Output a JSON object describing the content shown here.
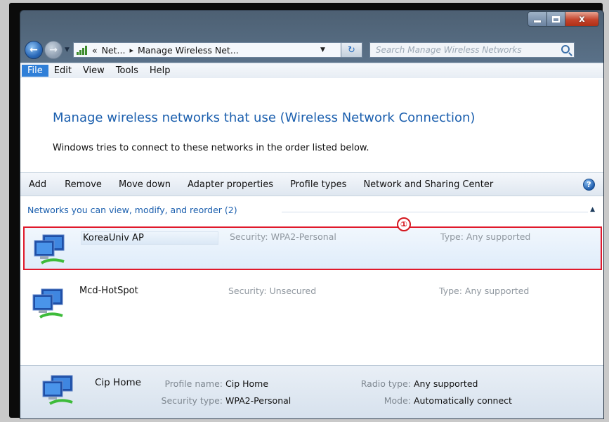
{
  "window": {
    "close_glyph": "x"
  },
  "address_bar": {
    "segment_1": "Net...",
    "segment_2": "Manage Wireless Net...",
    "search_placeholder": "Search Manage Wireless Networks"
  },
  "menu": {
    "items": [
      "File",
      "Edit",
      "View",
      "Tools",
      "Help"
    ]
  },
  "page": {
    "heading": "Manage wireless networks that use (Wireless Network Connection)",
    "subtext": "Windows tries to connect to these networks in the order listed below."
  },
  "toolbar": {
    "items": [
      "Add",
      "Remove",
      "Move down",
      "Adapter properties",
      "Profile types",
      "Network and Sharing Center"
    ]
  },
  "group": {
    "header": "Networks you can view, modify, and reorder (2)"
  },
  "annotation_marker": "①",
  "networks": [
    {
      "name": "KoreaUniv AP",
      "security": "Security:  WPA2-Personal",
      "type": "Type:  Any supported",
      "selected": true
    },
    {
      "name": "Mcd-HotSpot",
      "security": "Security:  Unsecured",
      "type": "Type:  Any supported",
      "selected": false
    }
  ],
  "details": {
    "name": "Cip Home",
    "profile_name_label": "Profile name:",
    "profile_name": "Cip Home",
    "security_type_label": "Security type:",
    "security_type": "WPA2-Personal",
    "radio_type_label": "Radio type:",
    "radio_type": "Any supported",
    "mode_label": "Mode:",
    "mode": "Automatically connect"
  },
  "colors": {
    "highlight_border": "#e0192b",
    "heading_blue": "#1b5fae",
    "menu_active": "#2f7fd8"
  }
}
